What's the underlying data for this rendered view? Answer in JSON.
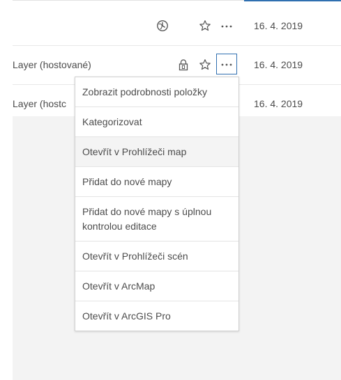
{
  "rows": [
    {
      "name": "",
      "date": "16. 4. 2019",
      "status_icon": "clock-globe-icon"
    },
    {
      "name": "Layer (hostované)",
      "date": "16. 4. 2019",
      "status_icon": "lock-icon"
    },
    {
      "name": "Layer (hostc",
      "date": "16. 4. 2019",
      "status_icon": ""
    }
  ],
  "icons": {
    "favorite": "star-outline-icon",
    "more": "ellipsis-icon"
  },
  "menu": {
    "items": [
      {
        "label": "Zobrazit podrobnosti položky"
      },
      {
        "label": "Kategorizovat"
      },
      {
        "label": "Otevřít v Prohlížeči map"
      },
      {
        "label": "Přidat do nové mapy"
      },
      {
        "label": "Přidat do nové mapy s úplnou kontrolou editace"
      },
      {
        "label": "Otevřít v Prohlížeči scén"
      },
      {
        "label": "Otevřít v ArcMap"
      },
      {
        "label": "Otevřít v ArcGIS Pro"
      }
    ]
  },
  "colors": {
    "accent": "#2f6fb0",
    "text": "#4c4c4c",
    "background_gray": "#f3f3f3"
  }
}
